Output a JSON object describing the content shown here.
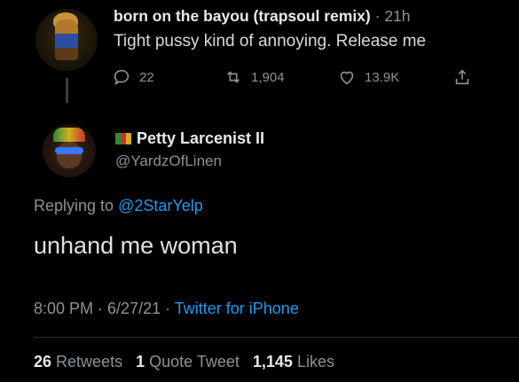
{
  "parent_tweet": {
    "display_name": "born on the bayou (trapsoul remix)",
    "separator": " · ",
    "time": "21h",
    "text": "Tight pussy kind of annoying. Release me",
    "actions": {
      "replies": "22",
      "retweets": "1,904",
      "likes": "13.9K"
    }
  },
  "main_tweet": {
    "display_name": "Petty Larcenist II",
    "handle": "@YardzOfLinen",
    "replying_prefix": "Replying to ",
    "replying_to": "@2StarYelp",
    "text": "unhand me woman",
    "datetime": "8:00 PM · 6/27/21 · ",
    "source": "Twitter for iPhone",
    "stats": {
      "retweets_count": "26",
      "retweets_label": "Retweets",
      "quote_count": "1",
      "quote_label": "Quote Tweet",
      "likes_count": "1,145",
      "likes_label": "Likes"
    }
  },
  "colors": {
    "background": "#000000",
    "link": "#1d9bf0",
    "muted": "#8b9298",
    "flag": [
      "#2b8a3e",
      "#c0392b",
      "#d4af1f"
    ]
  },
  "icons": [
    "reply-icon",
    "retweet-icon",
    "like-icon",
    "share-icon",
    "flag-icon"
  ]
}
